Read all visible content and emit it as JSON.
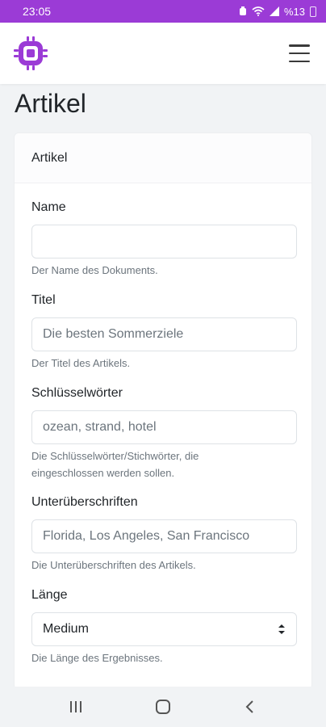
{
  "status_bar": {
    "time": "23:05",
    "battery": "%13"
  },
  "header": {
    "logo_icon": "chip-logo-icon",
    "menu_icon": "hamburger-menu-icon",
    "accent_color": "#9b3bd6"
  },
  "page": {
    "title": "Artikel"
  },
  "card": {
    "header": "Artikel",
    "fields": [
      {
        "label": "Name",
        "value": "",
        "placeholder": "",
        "help": "Der Name des Dokuments."
      },
      {
        "label": "Titel",
        "value": "",
        "placeholder": "Die besten Sommerziele",
        "help": "Der Titel des Artikels."
      },
      {
        "label": "Schlüsselwörter",
        "value": "",
        "placeholder": "ozean, strand, hotel",
        "help_line1": "Die Schlüsselwörter/Stichwörter, die",
        "help_line2": "eingeschlossen werden sollen."
      },
      {
        "label": "Unterüberschriften",
        "value": "",
        "placeholder": "Florida, Los Angeles, San Francisco",
        "help": "Die Unterüberschriften des Artikels."
      },
      {
        "label": "Länge",
        "selected": "Medium",
        "help": "Die Länge des Ergebnisses."
      }
    ]
  },
  "nav": {
    "recents_icon": "recent-apps-icon",
    "home_icon": "home-icon",
    "back_icon": "back-icon"
  }
}
